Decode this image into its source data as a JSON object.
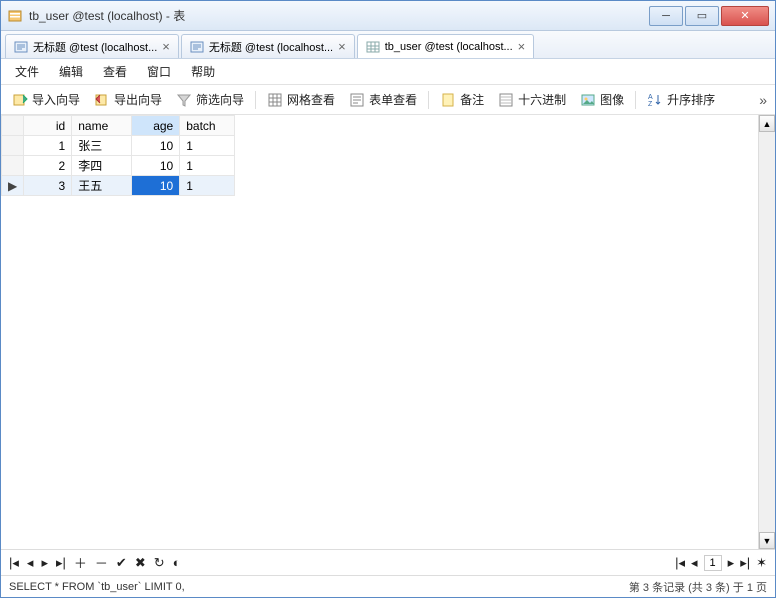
{
  "window": {
    "title": "tb_user @test (localhost) - 表"
  },
  "tabs": [
    {
      "label": "无标题 @test (localhost...",
      "active": false
    },
    {
      "label": "无标题 @test (localhost...",
      "active": false
    },
    {
      "label": "tb_user @test (localhost...",
      "active": true
    }
  ],
  "menu": {
    "file": "文件",
    "edit": "编辑",
    "view": "查看",
    "window": "窗口",
    "help": "帮助"
  },
  "toolbar": {
    "import": "导入向导",
    "export": "导出向导",
    "filter": "筛选向导",
    "gridview": "网格查看",
    "formview": "表单查看",
    "memo": "备注",
    "hex": "十六进制",
    "image": "图像",
    "sort": "升序排序"
  },
  "table": {
    "headers": {
      "id": "id",
      "name": "name",
      "age": "age",
      "batch": "batch"
    },
    "rows": [
      {
        "id": 1,
        "name": "张三",
        "age": 10,
        "batch": 1
      },
      {
        "id": 2,
        "name": "李四",
        "age": 10,
        "batch": 1
      },
      {
        "id": 3,
        "name": "王五",
        "age": 10,
        "batch": 1
      }
    ],
    "selected_row": 2,
    "selected_col": "age"
  },
  "nav": {
    "page": "1"
  },
  "status": {
    "sql": "SELECT * FROM `tb_user` LIMIT 0,",
    "info": "第 3 条记录 (共 3 条) 于 1 页"
  },
  "chart_data": {
    "type": "table",
    "columns": [
      "id",
      "name",
      "age",
      "batch"
    ],
    "rows": [
      [
        1,
        "张三",
        10,
        1
      ],
      [
        2,
        "李四",
        10,
        1
      ],
      [
        3,
        "王五",
        10,
        1
      ]
    ]
  }
}
